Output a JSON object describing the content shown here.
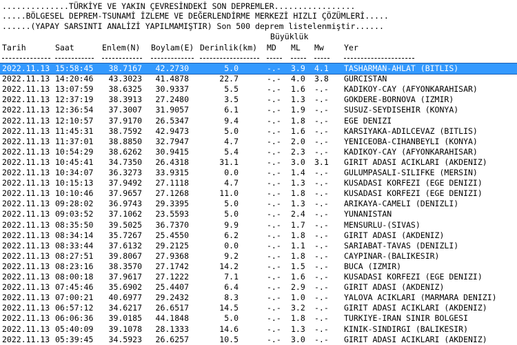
{
  "header": {
    "line1": "..............TÜRKİYE VE YAKIN ÇEVRESİNDEKİ SON DEPREMLER.................",
    "line2": ".....BÖLGESEL DEPREM-TSUNAMİ İZLEME VE DEĞERLENDİRME MERKEZİ HIZLI ÇÖZÜMLERİ.....",
    "line3": "......(YAPAY SARSINTI ANALİZİ YAPILMAMIŞTIR) Son 500 deprem listelenmiştir......"
  },
  "columns": {
    "group_magnitude": "Büyüklük",
    "date": "Tarih",
    "time": "Saat",
    "lat": "Enlem(N)",
    "lon": "Boylam(E)",
    "depth": "Derinlik(km)",
    "md": "MD",
    "ml": "ML",
    "mw": "Mw",
    "place": "Yer"
  },
  "rows": [
    {
      "date": "2022.11.13",
      "time": "15:58:45",
      "lat": "38.7167",
      "lon": "42.2730",
      "depth": "5.0",
      "md": "-.-",
      "ml": "3.9",
      "mw": "4.1",
      "place": "TASHARMAN-AHLAT (BITLIS)"
    },
    {
      "date": "2022.11.13",
      "time": "14:20:46",
      "lat": "43.3023",
      "lon": "41.4878",
      "depth": "22.7",
      "md": "-.-",
      "ml": "4.0",
      "mw": "3.8",
      "place": "GURCISTAN"
    },
    {
      "date": "2022.11.13",
      "time": "13:07:59",
      "lat": "38.6325",
      "lon": "30.9337",
      "depth": "5.5",
      "md": "-.-",
      "ml": "1.6",
      "mw": "-.-",
      "place": "KADIKOY-CAY (AFYONKARAHISAR)"
    },
    {
      "date": "2022.11.13",
      "time": "12:37:19",
      "lat": "38.3913",
      "lon": "27.2480",
      "depth": "3.5",
      "md": "-.-",
      "ml": "1.3",
      "mw": "-.-",
      "place": "GOKDERE-BORNOVA (IZMIR)"
    },
    {
      "date": "2022.11.13",
      "time": "12:36:54",
      "lat": "37.3007",
      "lon": "31.9057",
      "depth": "6.1",
      "md": "-.-",
      "ml": "1.9",
      "mw": "-.-",
      "place": "SUSUZ-SEYDISEHIR (KONYA)"
    },
    {
      "date": "2022.11.13",
      "time": "12:10:57",
      "lat": "37.9170",
      "lon": "26.5347",
      "depth": "9.4",
      "md": "-.-",
      "ml": "1.8",
      "mw": "-.-",
      "place": "EGE DENIZI"
    },
    {
      "date": "2022.11.13",
      "time": "11:45:31",
      "lat": "38.7592",
      "lon": "42.9473",
      "depth": "5.0",
      "md": "-.-",
      "ml": "1.6",
      "mw": "-.-",
      "place": "KARSIYAKA-ADILCEVAZ (BITLIS)"
    },
    {
      "date": "2022.11.13",
      "time": "11:37:01",
      "lat": "38.8850",
      "lon": "32.7947",
      "depth": "4.7",
      "md": "-.-",
      "ml": "2.0",
      "mw": "-.-",
      "place": "YENICEOBA-CIHANBEYLI (KONYA)"
    },
    {
      "date": "2022.11.13",
      "time": "10:54:29",
      "lat": "38.6262",
      "lon": "30.9415",
      "depth": "5.4",
      "md": "-.-",
      "ml": "2.3",
      "mw": "-.-",
      "place": "KADIKOY-CAY (AFYONKARAHISAR)"
    },
    {
      "date": "2022.11.13",
      "time": "10:45:41",
      "lat": "34.7350",
      "lon": "26.4318",
      "depth": "31.1",
      "md": "-.-",
      "ml": "3.0",
      "mw": "3.1",
      "place": "GIRIT ADASI ACIKLARI (AKDENIZ)"
    },
    {
      "date": "2022.11.13",
      "time": "10:34:07",
      "lat": "36.3273",
      "lon": "33.9315",
      "depth": "0.0",
      "md": "-.-",
      "ml": "1.4",
      "mw": "-.-",
      "place": "GULUMPASALI-SILIFKE (MERSIN)"
    },
    {
      "date": "2022.11.13",
      "time": "10:15:13",
      "lat": "37.9492",
      "lon": "27.1118",
      "depth": "4.7",
      "md": "-.-",
      "ml": "1.3",
      "mw": "-.-",
      "place": "KUSADASI KORFEZI (EGE DENIZI)"
    },
    {
      "date": "2022.11.13",
      "time": "10:10:46",
      "lat": "37.9657",
      "lon": "27.1268",
      "depth": "11.0",
      "md": "-.-",
      "ml": "1.8",
      "mw": "-.-",
      "place": "KUSADASI KORFEZI (EGE DENIZI)"
    },
    {
      "date": "2022.11.13",
      "time": "09:28:02",
      "lat": "36.9743",
      "lon": "29.3395",
      "depth": "5.0",
      "md": "-.-",
      "ml": "1.3",
      "mw": "-.-",
      "place": "ARIKAYA-CAMELI (DENIZLI)"
    },
    {
      "date": "2022.11.13",
      "time": "09:03:52",
      "lat": "37.1062",
      "lon": "23.5593",
      "depth": "5.0",
      "md": "-.-",
      "ml": "2.4",
      "mw": "-.-",
      "place": "YUNANISTAN"
    },
    {
      "date": "2022.11.13",
      "time": "08:35:50",
      "lat": "39.5025",
      "lon": "36.7370",
      "depth": "9.9",
      "md": "-.-",
      "ml": "1.7",
      "mw": "-.-",
      "place": "MENSURLU-(SIVAS)"
    },
    {
      "date": "2022.11.13",
      "time": "08:34:14",
      "lat": "35.7267",
      "lon": "25.4550",
      "depth": "6.2",
      "md": "-.-",
      "ml": "1.8",
      "mw": "-.-",
      "place": "GIRIT ADASI (AKDENIZ)"
    },
    {
      "date": "2022.11.13",
      "time": "08:33:44",
      "lat": "37.6132",
      "lon": "29.2125",
      "depth": "0.0",
      "md": "-.-",
      "ml": "1.1",
      "mw": "-.-",
      "place": "SARIABAT-TAVAS (DENIZLI)"
    },
    {
      "date": "2022.11.13",
      "time": "08:27:51",
      "lat": "39.8067",
      "lon": "27.9368",
      "depth": "9.2",
      "md": "-.-",
      "ml": "1.8",
      "mw": "-.-",
      "place": "CAYPINAR-(BALIKESIR)"
    },
    {
      "date": "2022.11.13",
      "time": "08:23:16",
      "lat": "38.3570",
      "lon": "27.1742",
      "depth": "14.2",
      "md": "-.-",
      "ml": "1.5",
      "mw": "-.-",
      "place": "BUCA (IZMIR)"
    },
    {
      "date": "2022.11.13",
      "time": "08:00:18",
      "lat": "37.9617",
      "lon": "27.1222",
      "depth": "7.1",
      "md": "-.-",
      "ml": "1.6",
      "mw": "-.-",
      "place": "KUSADASI KORFEZI (EGE DENIZI)"
    },
    {
      "date": "2022.11.13",
      "time": "07:45:46",
      "lat": "35.6902",
      "lon": "25.4407",
      "depth": "6.4",
      "md": "-.-",
      "ml": "2.9",
      "mw": "-.-",
      "place": "GIRIT ADASI (AKDENIZ)"
    },
    {
      "date": "2022.11.13",
      "time": "07:00:21",
      "lat": "40.6977",
      "lon": "29.2432",
      "depth": "8.3",
      "md": "-.-",
      "ml": "1.0",
      "mw": "-.-",
      "place": "YALOVA ACIKLARI (MARMARA DENIZI)"
    },
    {
      "date": "2022.11.13",
      "time": "06:57:12",
      "lat": "34.6217",
      "lon": "26.6517",
      "depth": "14.5",
      "md": "-.-",
      "ml": "3.2",
      "mw": "-.-",
      "place": "GIRIT ADASI ACIKLARI (AKDENIZ)"
    },
    {
      "date": "2022.11.13",
      "time": "06:06:36",
      "lat": "39.0185",
      "lon": "44.1848",
      "depth": "5.0",
      "md": "-.-",
      "ml": "1.8",
      "mw": "-.-",
      "place": "TURKIYE-IRAN SINIR BOLGESI"
    },
    {
      "date": "2022.11.13",
      "time": "05:40:09",
      "lat": "39.1078",
      "lon": "28.1333",
      "depth": "14.6",
      "md": "-.-",
      "ml": "1.3",
      "mw": "-.-",
      "place": "KINIK-SINDIRGI (BALIKESIR)"
    },
    {
      "date": "2022.11.13",
      "time": "05:39:45",
      "lat": "34.5923",
      "lon": "26.6257",
      "depth": "10.5",
      "md": "-.-",
      "ml": "3.0",
      "mw": "-.-",
      "place": "GIRIT ADASI ACIKLARI (AKDENIZ)"
    }
  ],
  "colors": {
    "selection_bg": "#3399ff",
    "selection_text": "#ffffff",
    "text": "#000000"
  }
}
